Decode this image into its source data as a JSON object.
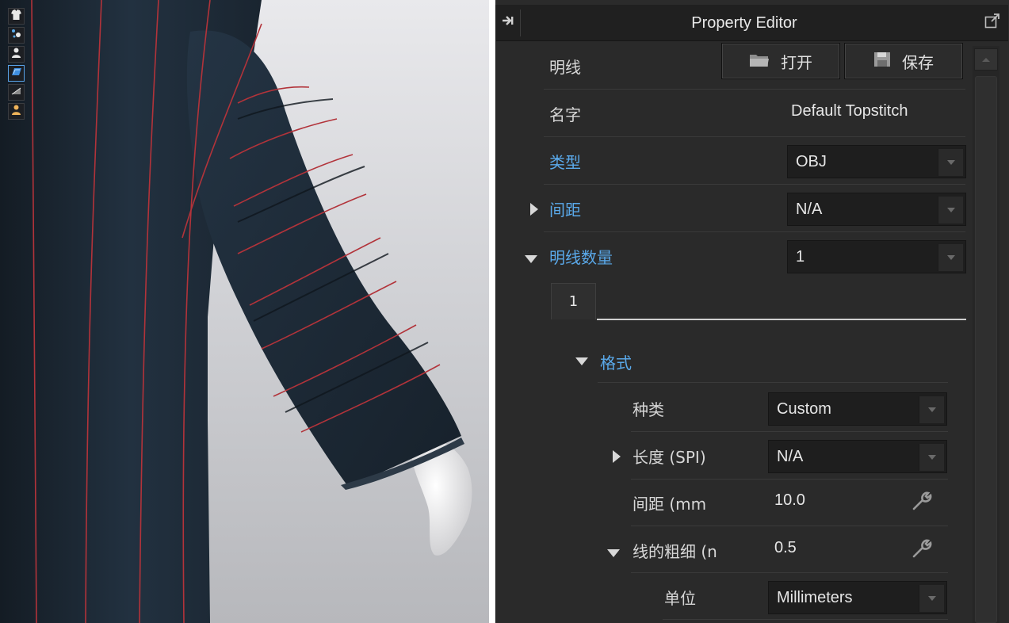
{
  "viewport": {
    "toolbar": [
      {
        "icon": "garment-icon"
      },
      {
        "icon": "avatar-points-icon"
      },
      {
        "icon": "avatar-icon"
      },
      {
        "icon": "texture-surface-icon",
        "active": true
      },
      {
        "icon": "wireframe-icon"
      },
      {
        "icon": "skin-avatar-icon"
      }
    ]
  },
  "panel": {
    "title": "Property Editor",
    "section_label": "明线",
    "open_label": "打开",
    "save_label": "保存",
    "name_label": "名字",
    "name_value": "Default Topstitch",
    "type_label": "类型",
    "type_value": "OBJ",
    "spacing_label": "间距",
    "spacing_value": "N/A",
    "count_label": "明线数量",
    "count_value": "1",
    "tab_label": "1",
    "format_label": "格式",
    "kind_label": "种类",
    "kind_value": "Custom",
    "length_label": "长度 (SPI)",
    "length_value": "N/A",
    "gap_label": "间距 (mm",
    "gap_value": "10.0",
    "thickness_label": "线的粗细 (n",
    "thickness_value": "0.5",
    "unit_label": "单位",
    "unit_value": "Millimeters"
  },
  "colors": {
    "panel_bg": "#2a2a2a",
    "accent_blue": "#5aa9ea",
    "stitch_red": "#b2333a",
    "garment": "#1e2a35"
  }
}
